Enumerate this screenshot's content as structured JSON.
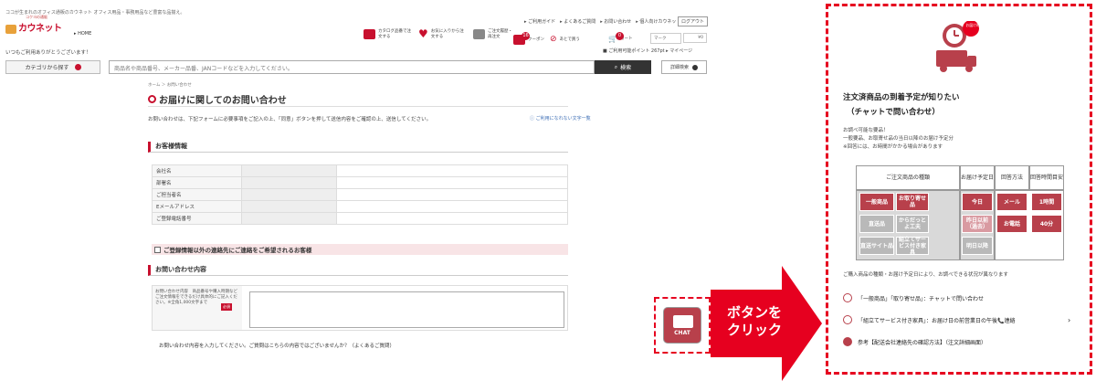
{
  "header": {
    "tagline": "ココが生まれのオフィス通販のカウネット オフィス用品・事務用品など豊富な品揃え。",
    "logo_sub": "コクヨの通販",
    "logo": "カウネット",
    "home": "▸ HOME",
    "greeting": "いつもご利用ありがとうございます！",
    "util_links": "▸ ご利用ガイド　▸ よくあるご質問　▸ お問い合わせ　▸ 個人向けカウネット",
    "logout": "ログアウト",
    "icons": [
      {
        "label": "カタログ品番で注文する",
        "icon": "catalog-icon"
      },
      {
        "label": "お気に入りから注文する",
        "icon": "heart-icon"
      },
      {
        "label": "ご注文履歴・再注文",
        "icon": "history-icon"
      },
      {
        "label": "クーポン",
        "icon": "coupon-icon",
        "badge": "16"
      },
      {
        "label": "あとで買う",
        "icon": "clip-icon"
      },
      {
        "label": "カート",
        "icon": "cart-icon",
        "badge": "0"
      }
    ],
    "mini1": "マーク",
    "mini2": "¥0",
    "points": "■ ご利用可能ポイント 267pt ▸ マイページ",
    "cat_button": "カテゴリから探す",
    "search_placeholder": "商品名や商品番号、メーカー品番、JANコードなどを入力してください。",
    "search_button": "検索",
    "detail_search": "詳細検索"
  },
  "page": {
    "breadcrumb": "ホーム ＞ お問い合わせ",
    "title": "お届けに関してのお問い合わせ",
    "intro": "お問い合わせは、下記フォームに必要事項をご記入の上、「同意」ボタンを押して送信内容をご確認の上、送信してください。",
    "faq_link": "ⓘ ご利用になれない文字一覧",
    "customer_section": "お客様情報",
    "fields": [
      "会社名",
      "部署名",
      "ご担当者名",
      "Eメールアドレス",
      "ご登録電話番号"
    ],
    "other_contact": "ご登録情報以外の連絡先にご連絡をご希望されるお客様",
    "inquiry_section": "お問い合わせ内容",
    "inquiry_label": "お問い合わせ内容　商品番号や購入時期など　ご注文情報をできるだけ具体的にご記入ください。※全角1,000文字まで",
    "required": "必須",
    "bottom_text": "お問い合わせ内容を入力してください。ご質問はこちらの内容ではございませんか？（よくあるご質問）"
  },
  "chat_button": {
    "label": "CHAT"
  },
  "callout": {
    "line1": "ボタンを",
    "line2": "クリック"
  },
  "panel": {
    "badge_text": "お届け時期",
    "title1": "注文済商品の到着予定が知りたい",
    "title2": "（チャットで問い合わせ）",
    "desc1": "お調べ可能な要品！",
    "desc2": "一般要品、お取寄せ品の当日以降のお届け予定分",
    "desc3": "※回答には、お時間がかかる場合があります",
    "headers": [
      "ご注文商品の種類",
      "お届け予定日",
      "回答方法",
      "回答時間目安"
    ],
    "cells": [
      {
        "label": "一般商品",
        "state": "on"
      },
      {
        "label": "お取り寄せ品",
        "state": "on"
      },
      {
        "label": "今日",
        "state": "on"
      },
      {
        "label": "メール",
        "state": "on"
      },
      {
        "label": "1時間",
        "state": "on"
      },
      {
        "label": "直送品",
        "state": "off"
      },
      {
        "label": "からだっとよ工夫",
        "state": "off"
      },
      {
        "label": "昨日以前（過去）",
        "state": "on2"
      },
      {
        "label": "お電話",
        "state": "on"
      },
      {
        "label": "40分",
        "state": "on"
      },
      {
        "label": "直送サイト品",
        "state": "off"
      },
      {
        "label": "組立てサービス付き家具",
        "state": "off"
      },
      {
        "label": "明日以降",
        "state": "off"
      }
    ],
    "note": "ご購入商品の種類・お届け予定日により、お調べできる状況が異なります",
    "option1": "「一般商品」「取り寄せ品」：チャットで問い合わせ",
    "option2": "「組立てサービス付き家具」：お届け日の前営業日の午後📞連絡",
    "option3": "参考【配送会社連絡先の確認方法】（注文詳細画面）"
  },
  "colors": {
    "brand": "#c8102e",
    "accent": "#b8404b",
    "callout": "#e6001f"
  }
}
